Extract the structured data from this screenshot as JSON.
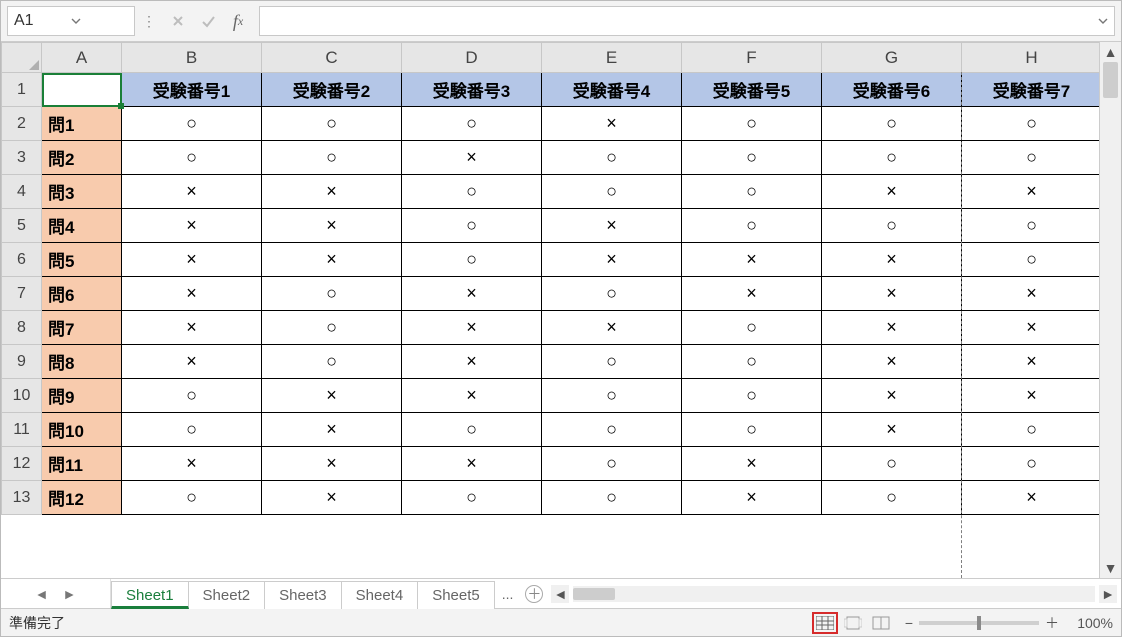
{
  "name_box": "A1",
  "formula": "",
  "columns": [
    "A",
    "B",
    "C",
    "D",
    "E",
    "F",
    "G",
    "H"
  ],
  "row_numbers": [
    1,
    2,
    3,
    4,
    5,
    6,
    7,
    8,
    9,
    10,
    11,
    12,
    13
  ],
  "header_row": [
    "",
    "受験番号1",
    "受験番号2",
    "受験番号3",
    "受験番号4",
    "受験番号5",
    "受験番号6",
    "受験番号7"
  ],
  "data_rows": [
    {
      "label": "問1",
      "v": [
        "○",
        "○",
        "○",
        "×",
        "○",
        "○",
        "○"
      ]
    },
    {
      "label": "問2",
      "v": [
        "○",
        "○",
        "×",
        "○",
        "○",
        "○",
        "○"
      ]
    },
    {
      "label": "問3",
      "v": [
        "×",
        "×",
        "○",
        "○",
        "○",
        "×",
        "×"
      ]
    },
    {
      "label": "問4",
      "v": [
        "×",
        "×",
        "○",
        "×",
        "○",
        "○",
        "○"
      ]
    },
    {
      "label": "問5",
      "v": [
        "×",
        "×",
        "○",
        "×",
        "×",
        "×",
        "○"
      ]
    },
    {
      "label": "問6",
      "v": [
        "×",
        "○",
        "×",
        "○",
        "×",
        "×",
        "×"
      ]
    },
    {
      "label": "問7",
      "v": [
        "×",
        "○",
        "×",
        "×",
        "○",
        "×",
        "×"
      ]
    },
    {
      "label": "問8",
      "v": [
        "×",
        "○",
        "×",
        "○",
        "○",
        "×",
        "×"
      ]
    },
    {
      "label": "問9",
      "v": [
        "○",
        "×",
        "×",
        "○",
        "○",
        "×",
        "×"
      ]
    },
    {
      "label": "問10",
      "v": [
        "○",
        "×",
        "○",
        "○",
        "○",
        "×",
        "○"
      ]
    },
    {
      "label": "問11",
      "v": [
        "×",
        "×",
        "×",
        "○",
        "×",
        "○",
        "○"
      ]
    },
    {
      "label": "問12",
      "v": [
        "○",
        "×",
        "○",
        "○",
        "×",
        "○",
        "×"
      ]
    }
  ],
  "tabs": [
    "Sheet1",
    "Sheet2",
    "Sheet3",
    "Sheet4",
    "Sheet5"
  ],
  "active_tab": 0,
  "tab_more": "...",
  "status": "準備完了",
  "zoom": "100%"
}
